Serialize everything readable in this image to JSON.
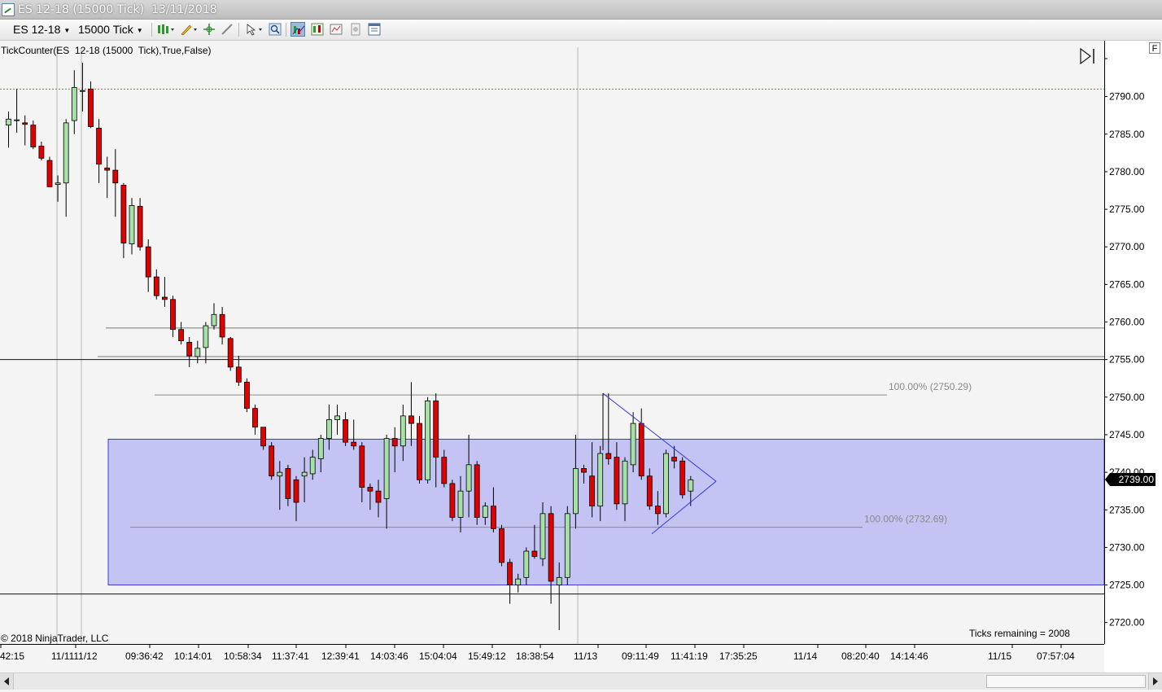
{
  "window": {
    "title": "ES 12-18 (15000 Tick)  13/11/2018"
  },
  "toolbar": {
    "instrument": "ES 12-18",
    "interval": "15000 Tick",
    "buttons": [
      {
        "name": "bar-type-icon"
      },
      {
        "name": "drawing-tool-icon"
      },
      {
        "name": "crosshair-icon"
      },
      {
        "name": "pointer-icon"
      },
      {
        "name": "zoom-icon"
      },
      {
        "name": "indicators-icon"
      },
      {
        "name": "strategies-icon"
      },
      {
        "name": "chart-trader-icon"
      },
      {
        "name": "properties-icon"
      },
      {
        "name": "data-box-icon"
      }
    ]
  },
  "chart": {
    "indicator_label": "TickCounter(ES  12-18 (15000  Tick),True,False)",
    "copyright": "© 2018 NinjaTrader, LLC",
    "ticks_remaining": "Ticks remaining = 2008",
    "f_button": "F",
    "last_price_tag": "2739.00",
    "fib_labels": [
      {
        "text": "100.00% (2750.29)",
        "price": 2750.29
      },
      {
        "text": "100.00% (2732.69)",
        "price": 2732.69
      }
    ],
    "colors": {
      "up_candle": "#a6e0a6",
      "down_candle": "#e00000",
      "zone_fill": "#c4c4f4",
      "zone_border": "#3a3ad0",
      "triangle": "#3a3ae6",
      "price_tag": "#000000"
    }
  },
  "chart_data": {
    "type": "candlestick",
    "y_axis": {
      "range": [
        2717,
        2797
      ],
      "tick_labels": [
        "2790.00",
        "2785.00",
        "2780.00",
        "2775.00",
        "2770.00",
        "2765.00",
        "2760.00",
        "2755.00",
        "2750.00",
        "2745.00",
        "2740.00",
        "2735.00",
        "2730.00",
        "2725.00",
        "2720.00"
      ],
      "tick_values": [
        2790,
        2785,
        2780,
        2775,
        2770,
        2765,
        2760,
        2755,
        2750,
        2745,
        2740,
        2735,
        2730,
        2725,
        2720
      ]
    },
    "x_axis": {
      "tick_labels": [
        "42:15",
        "11/1111/12",
        "09:36:42",
        "10:14:01",
        "10:58:34",
        "11:37:41",
        "12:39:41",
        "14:03:46",
        "15:04:04",
        "15:49:12",
        "18:38:54",
        "11/13",
        "09:11:49",
        "11:41:19",
        "17:35:25",
        "11/14",
        "08:20:40",
        "14:14:46",
        "11/15",
        "07:57:04"
      ]
    },
    "candles": [
      {
        "o": 2786.2,
        "h": 2788.0,
        "l": 2783.2,
        "c": 2787.0
      },
      {
        "o": 2786.8,
        "h": 2791.0,
        "l": 2785.2,
        "c": 2786.9
      },
      {
        "o": 2786.5,
        "h": 2787.5,
        "l": 2783.5,
        "c": 2786.3
      },
      {
        "o": 2786.2,
        "h": 2786.8,
        "l": 2783.0,
        "c": 2783.3
      },
      {
        "o": 2783.4,
        "h": 2784.0,
        "l": 2781.5,
        "c": 2781.8
      },
      {
        "o": 2781.5,
        "h": 2782.0,
        "l": 2778.0,
        "c": 2778.0
      },
      {
        "o": 2778.3,
        "h": 2779.5,
        "l": 2776.0,
        "c": 2778.5
      },
      {
        "o": 2778.5,
        "h": 2787.0,
        "l": 2774.0,
        "c": 2786.5
      },
      {
        "o": 2786.8,
        "h": 2793.5,
        "l": 2785.0,
        "c": 2791.2
      },
      {
        "o": 2790.8,
        "h": 2794.5,
        "l": 2788.0,
        "c": 2790.8
      },
      {
        "o": 2791.0,
        "h": 2792.0,
        "l": 2785.8,
        "c": 2786.0
      },
      {
        "o": 2785.8,
        "h": 2787.0,
        "l": 2778.5,
        "c": 2781.0
      },
      {
        "o": 2780.5,
        "h": 2782.0,
        "l": 2776.5,
        "c": 2780.2
      },
      {
        "o": 2780.2,
        "h": 2783.0,
        "l": 2774.0,
        "c": 2778.5
      },
      {
        "o": 2778.2,
        "h": 2778.5,
        "l": 2768.5,
        "c": 2770.5
      },
      {
        "o": 2770.4,
        "h": 2776.5,
        "l": 2769.0,
        "c": 2775.5
      },
      {
        "o": 2775.4,
        "h": 2776.5,
        "l": 2769.5,
        "c": 2770.0
      },
      {
        "o": 2770.0,
        "h": 2771.0,
        "l": 2764.0,
        "c": 2766.0
      },
      {
        "o": 2766.0,
        "h": 2767.0,
        "l": 2763.0,
        "c": 2763.5
      },
      {
        "o": 2763.3,
        "h": 2766.0,
        "l": 2762.0,
        "c": 2763.0
      },
      {
        "o": 2763.0,
        "h": 2763.5,
        "l": 2758.0,
        "c": 2759.0
      },
      {
        "o": 2759.0,
        "h": 2760.0,
        "l": 2757.0,
        "c": 2757.5
      },
      {
        "o": 2757.3,
        "h": 2758.0,
        "l": 2754.0,
        "c": 2755.5
      },
      {
        "o": 2755.4,
        "h": 2757.5,
        "l": 2754.5,
        "c": 2756.5
      },
      {
        "o": 2756.6,
        "h": 2760.0,
        "l": 2754.5,
        "c": 2759.5
      },
      {
        "o": 2759.5,
        "h": 2762.5,
        "l": 2759.0,
        "c": 2761.0
      },
      {
        "o": 2761.0,
        "h": 2762.0,
        "l": 2757.0,
        "c": 2758.0
      },
      {
        "o": 2757.8,
        "h": 2758.0,
        "l": 2753.5,
        "c": 2754.0
      },
      {
        "o": 2754.0,
        "h": 2755.5,
        "l": 2751.5,
        "c": 2752.0
      },
      {
        "o": 2752.0,
        "h": 2752.5,
        "l": 2748.0,
        "c": 2748.5
      },
      {
        "o": 2748.5,
        "h": 2749.0,
        "l": 2745.0,
        "c": 2746.0
      },
      {
        "o": 2746.0,
        "h": 2746.0,
        "l": 2743.0,
        "c": 2743.5
      },
      {
        "o": 2743.5,
        "h": 2744.0,
        "l": 2739.0,
        "c": 2739.5
      },
      {
        "o": 2739.5,
        "h": 2741.5,
        "l": 2735.0,
        "c": 2740.0
      },
      {
        "o": 2740.5,
        "h": 2741.0,
        "l": 2735.5,
        "c": 2736.5
      },
      {
        "o": 2739.0,
        "h": 2739.5,
        "l": 2733.5,
        "c": 2736.0
      },
      {
        "o": 2739.5,
        "h": 2742.0,
        "l": 2736.0,
        "c": 2740.0
      },
      {
        "o": 2739.8,
        "h": 2743.0,
        "l": 2739.0,
        "c": 2742.0
      },
      {
        "o": 2741.8,
        "h": 2745.0,
        "l": 2740.0,
        "c": 2744.5
      },
      {
        "o": 2744.5,
        "h": 2749.0,
        "l": 2743.0,
        "c": 2747.0
      },
      {
        "o": 2747.0,
        "h": 2749.0,
        "l": 2745.0,
        "c": 2747.5
      },
      {
        "o": 2747.0,
        "h": 2748.0,
        "l": 2743.5,
        "c": 2744.0
      },
      {
        "o": 2744.0,
        "h": 2747.0,
        "l": 2743.0,
        "c": 2743.5
      },
      {
        "o": 2743.5,
        "h": 2744.0,
        "l": 2736.0,
        "c": 2738.0
      },
      {
        "o": 2738.0,
        "h": 2738.5,
        "l": 2735.0,
        "c": 2737.5
      },
      {
        "o": 2737.5,
        "h": 2739.0,
        "l": 2734.0,
        "c": 2736.0
      },
      {
        "o": 2736.5,
        "h": 2745.0,
        "l": 2732.5,
        "c": 2744.5
      },
      {
        "o": 2744.5,
        "h": 2746.0,
        "l": 2740.0,
        "c": 2743.5
      },
      {
        "o": 2743.5,
        "h": 2749.0,
        "l": 2741.5,
        "c": 2747.5
      },
      {
        "o": 2747.5,
        "h": 2752.0,
        "l": 2743.5,
        "c": 2746.5
      },
      {
        "o": 2746.5,
        "h": 2747.5,
        "l": 2738.5,
        "c": 2739.0
      },
      {
        "o": 2739.0,
        "h": 2750.0,
        "l": 2738.5,
        "c": 2749.5
      },
      {
        "o": 2749.5,
        "h": 2750.5,
        "l": 2738.0,
        "c": 2742.0
      },
      {
        "o": 2742.0,
        "h": 2743.0,
        "l": 2738.0,
        "c": 2738.5
      },
      {
        "o": 2738.5,
        "h": 2739.0,
        "l": 2733.5,
        "c": 2734.0
      },
      {
        "o": 2734.0,
        "h": 2739.5,
        "l": 2732.0,
        "c": 2737.5
      },
      {
        "o": 2737.5,
        "h": 2745.0,
        "l": 2734.0,
        "c": 2741.0
      },
      {
        "o": 2741.0,
        "h": 2741.5,
        "l": 2733.0,
        "c": 2734.0
      },
      {
        "o": 2734.0,
        "h": 2736.0,
        "l": 2733.0,
        "c": 2735.5
      },
      {
        "o": 2735.5,
        "h": 2738.0,
        "l": 2732.0,
        "c": 2732.5
      },
      {
        "o": 2732.5,
        "h": 2733.0,
        "l": 2727.5,
        "c": 2728.0
      },
      {
        "o": 2728.0,
        "h": 2728.5,
        "l": 2722.5,
        "c": 2725.0
      },
      {
        "o": 2725.0,
        "h": 2726.5,
        "l": 2724.0,
        "c": 2725.8
      },
      {
        "o": 2726.0,
        "h": 2730.0,
        "l": 2725.0,
        "c": 2729.5
      },
      {
        "o": 2729.5,
        "h": 2733.0,
        "l": 2728.5,
        "c": 2728.8
      },
      {
        "o": 2728.5,
        "h": 2736.0,
        "l": 2727.5,
        "c": 2734.5
      },
      {
        "o": 2734.5,
        "h": 2735.5,
        "l": 2722.5,
        "c": 2725.5
      },
      {
        "o": 2725.0,
        "h": 2728.0,
        "l": 2719.0,
        "c": 2726.0
      },
      {
        "o": 2726.0,
        "h": 2735.5,
        "l": 2725.0,
        "c": 2734.5
      },
      {
        "o": 2734.5,
        "h": 2745.0,
        "l": 2732.5,
        "c": 2740.5
      },
      {
        "o": 2740.5,
        "h": 2741.0,
        "l": 2738.5,
        "c": 2740.0
      },
      {
        "o": 2739.5,
        "h": 2744.0,
        "l": 2734.0,
        "c": 2735.5
      },
      {
        "o": 2735.5,
        "h": 2743.5,
        "l": 2733.5,
        "c": 2742.5
      },
      {
        "o": 2742.5,
        "h": 2750.5,
        "l": 2741.0,
        "c": 2741.8
      },
      {
        "o": 2742.0,
        "h": 2744.0,
        "l": 2735.0,
        "c": 2735.8
      },
      {
        "o": 2735.8,
        "h": 2742.0,
        "l": 2733.5,
        "c": 2741.5
      },
      {
        "o": 2741.0,
        "h": 2748.0,
        "l": 2740.0,
        "c": 2746.5
      },
      {
        "o": 2746.5,
        "h": 2748.5,
        "l": 2739.0,
        "c": 2739.5
      },
      {
        "o": 2739.5,
        "h": 2740.5,
        "l": 2735.0,
        "c": 2735.5
      },
      {
        "o": 2735.5,
        "h": 2737.5,
        "l": 2733.0,
        "c": 2734.5
      },
      {
        "o": 2734.5,
        "h": 2743.0,
        "l": 2734.0,
        "c": 2742.5
      },
      {
        "o": 2742.0,
        "h": 2743.5,
        "l": 2740.5,
        "c": 2741.5
      },
      {
        "o": 2741.5,
        "h": 2742.0,
        "l": 2736.5,
        "c": 2737.0
      },
      {
        "o": 2737.5,
        "h": 2739.5,
        "l": 2735.5,
        "c": 2739.0
      }
    ],
    "horizontal_lines": [
      {
        "price": 2791.0,
        "style": "dotted-red"
      },
      {
        "price": 2759.2,
        "style": "thin-gray"
      },
      {
        "price": 2755.4,
        "style": "thin-gray"
      },
      {
        "price": 2755.0,
        "style": "solid-black"
      },
      {
        "price": 2723.8,
        "style": "solid-black"
      },
      {
        "price": 2750.29,
        "style": "fib-gray"
      },
      {
        "price": 2732.69,
        "style": "fib-gray"
      }
    ],
    "zone": {
      "top": 2744.4,
      "bottom": 2725.0
    },
    "triangle": {
      "apex_top_price": 2750.5,
      "apex_bottom_price": 2731.8,
      "apex_right_price": 2738.8
    }
  }
}
